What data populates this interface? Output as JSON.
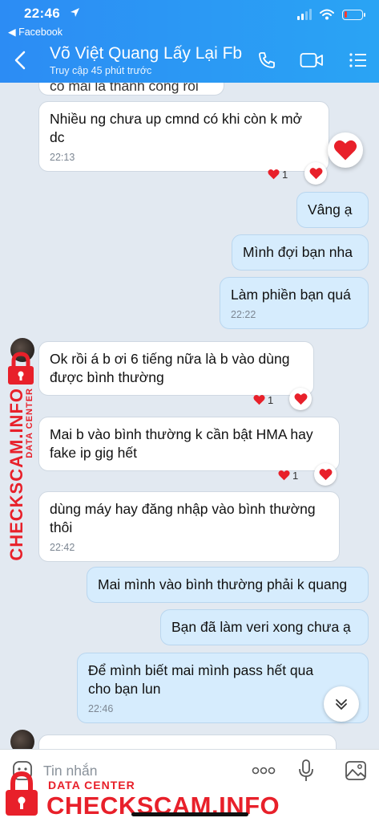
{
  "status_bar": {
    "time": "22:46",
    "back_app": "◀ Facebook"
  },
  "header": {
    "title": "Võ Việt Quang Lấy Lại Fb",
    "subtitle": "Truy cập 45 phút trước"
  },
  "messages": [
    {
      "side": "in",
      "text": "Nhiều ng chưa up cmnd có khi còn k mở dc",
      "time": "22:13",
      "reaction_count": "1"
    },
    {
      "side": "out",
      "text": "Vâng ạ"
    },
    {
      "side": "out",
      "text": "Mình đợi bạn nha"
    },
    {
      "side": "out",
      "text": "Làm phiền bạn quá",
      "time": "22:22"
    },
    {
      "side": "in",
      "text": "Ok rồi á b ơi 6 tiếng nữa là b vào dùng được bình thường",
      "reaction_count": "1"
    },
    {
      "side": "in",
      "text": "Mai b vào bình thường k cần bật HMA hay fake ip gig hết",
      "reaction_count": "1"
    },
    {
      "side": "in",
      "text": "dùng máy hay đăng nhập vào bình thường thôi",
      "time": "22:42"
    },
    {
      "side": "out",
      "text": "Mai mình vào bình thường phải k quang"
    },
    {
      "side": "out",
      "text": "Bạn đã làm veri xong chưa ạ"
    },
    {
      "side": "out",
      "text": "Để mình biết mai mình pass hết qua cho bạn lun",
      "time": "22:46"
    }
  ],
  "partial_top_text": "co mai la thanh cong roi",
  "input": {
    "placeholder": "Tin nhắn"
  },
  "watermark": {
    "small": "DATA CENTER",
    "big": "CHECKSCAM.INFO"
  },
  "colors": {
    "header": "#2a98f4",
    "outgoing_bubble": "#d6ecfd",
    "incoming_bubble": "#ffffff",
    "heart": "#e8202a",
    "watermark": "#e8202a"
  },
  "icons": [
    "back-icon",
    "phone-icon",
    "video-icon",
    "menu-icon",
    "heart-icon",
    "chevron-down-icon",
    "sticker-icon",
    "more-icon",
    "microphone-icon",
    "image-icon",
    "lock-icon"
  ]
}
